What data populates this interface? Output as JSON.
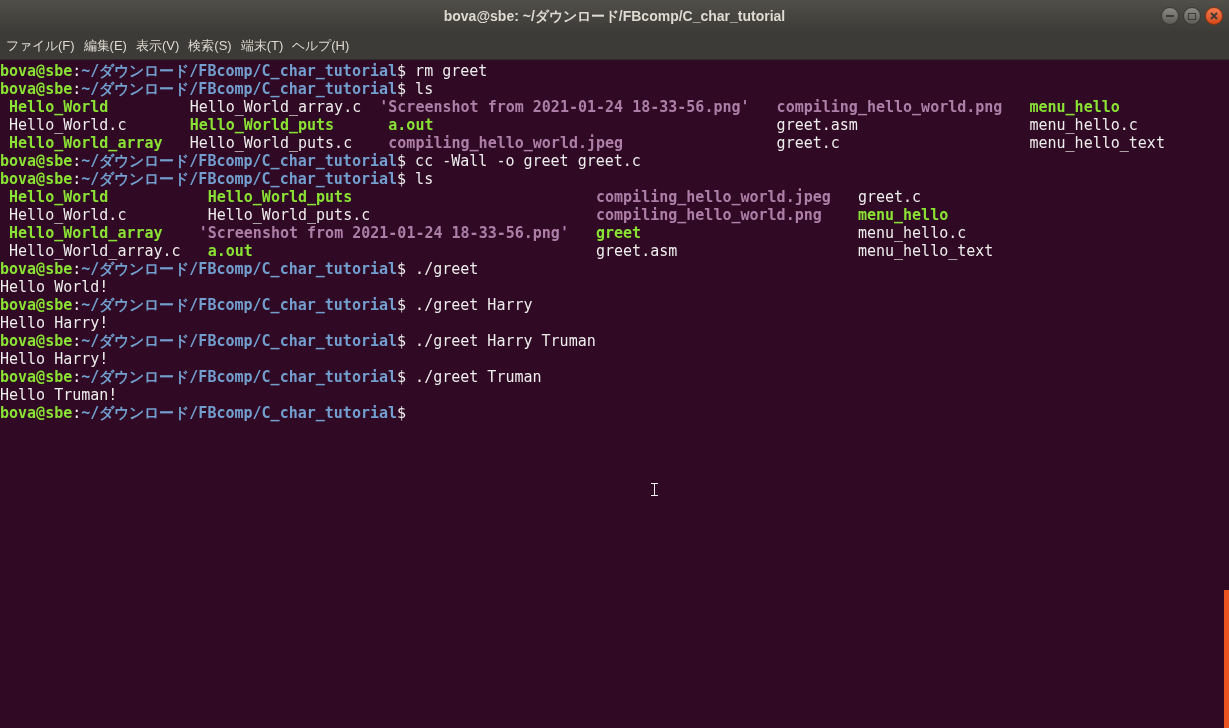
{
  "window": {
    "title": "bova@sbe: ~/ダウンロード/FBcomp/C_char_tutorial"
  },
  "menu": [
    "ファイル(F)",
    "編集(E)",
    "表示(V)",
    "検索(S)",
    "端末(T)",
    "ヘルプ(H)"
  ],
  "terminal": [
    {
      "kind": "prompt",
      "user": "bova@sbe",
      "sep": ":",
      "path": "~/ダウンロード/FBcomp/C_char_tutorial",
      "symbol": "$",
      "command": "rm greet"
    },
    {
      "kind": "prompt",
      "user": "bova@sbe",
      "sep": ":",
      "path": "~/ダウンロード/FBcomp/C_char_tutorial",
      "symbol": "$",
      "command": "ls"
    },
    {
      "kind": "listing",
      "columns": [
        [
          {
            "name": "Hello_World",
            "kind": "exec",
            "quoted": false
          },
          {
            "name": "Hello_World.c",
            "kind": "file",
            "quoted": false
          },
          {
            "name": "Hello_World_array",
            "kind": "exec",
            "quoted": false
          }
        ],
        [
          {
            "name": "Hello_World_array.c",
            "kind": "file",
            "quoted": false
          },
          {
            "name": "Hello_World_puts",
            "kind": "exec",
            "quoted": false
          },
          {
            "name": "Hello_World_puts.c",
            "kind": "file",
            "quoted": false
          }
        ],
        [
          {
            "name": "'Screenshot from 2021-01-24 18-33-56.png'",
            "kind": "image",
            "quoted": true
          },
          {
            "name": "a.out",
            "kind": "exec",
            "quoted": false
          },
          {
            "name": "compiling_hello_world.jpeg",
            "kind": "image",
            "quoted": false
          }
        ],
        [
          {
            "name": "compiling_hello_world.png",
            "kind": "image",
            "quoted": false
          },
          {
            "name": "greet.asm",
            "kind": "file",
            "quoted": false
          },
          {
            "name": "greet.c",
            "kind": "file",
            "quoted": false
          }
        ],
        [
          {
            "name": "menu_hello",
            "kind": "exec",
            "quoted": false
          },
          {
            "name": "menu_hello.c",
            "kind": "file",
            "quoted": false
          },
          {
            "name": "menu_hello_text",
            "kind": "file",
            "quoted": false
          }
        ]
      ]
    },
    {
      "kind": "prompt",
      "user": "bova@sbe",
      "sep": ":",
      "path": "~/ダウンロード/FBcomp/C_char_tutorial",
      "symbol": "$",
      "command": "cc -Wall -o greet greet.c"
    },
    {
      "kind": "prompt",
      "user": "bova@sbe",
      "sep": ":",
      "path": "~/ダウンロード/FBcomp/C_char_tutorial",
      "symbol": "$",
      "command": "ls"
    },
    {
      "kind": "listing",
      "columns": [
        [
          {
            "name": "Hello_World",
            "kind": "exec",
            "quoted": false
          },
          {
            "name": "Hello_World.c",
            "kind": "file",
            "quoted": false
          },
          {
            "name": "Hello_World_array",
            "kind": "exec",
            "quoted": false
          },
          {
            "name": "Hello_World_array.c",
            "kind": "file",
            "quoted": false
          }
        ],
        [
          {
            "name": "Hello_World_puts",
            "kind": "exec",
            "quoted": false
          },
          {
            "name": "Hello_World_puts.c",
            "kind": "file",
            "quoted": false
          },
          {
            "name": "'Screenshot from 2021-01-24 18-33-56.png'",
            "kind": "image",
            "quoted": true
          },
          {
            "name": "a.out",
            "kind": "exec",
            "quoted": false
          }
        ],
        [
          {
            "name": "compiling_hello_world.jpeg",
            "kind": "image",
            "quoted": false
          },
          {
            "name": "compiling_hello_world.png",
            "kind": "image",
            "quoted": false
          },
          {
            "name": "greet",
            "kind": "exec",
            "quoted": false
          },
          {
            "name": "greet.asm",
            "kind": "file",
            "quoted": false
          }
        ],
        [
          {
            "name": "greet.c",
            "kind": "file",
            "quoted": false
          },
          {
            "name": "menu_hello",
            "kind": "exec",
            "quoted": false
          },
          {
            "name": "menu_hello.c",
            "kind": "file",
            "quoted": false
          },
          {
            "name": "menu_hello_text",
            "kind": "file",
            "quoted": false
          }
        ]
      ]
    },
    {
      "kind": "prompt",
      "user": "bova@sbe",
      "sep": ":",
      "path": "~/ダウンロード/FBcomp/C_char_tutorial",
      "symbol": "$",
      "command": "./greet"
    },
    {
      "kind": "output",
      "text": "Hello World!"
    },
    {
      "kind": "prompt",
      "user": "bova@sbe",
      "sep": ":",
      "path": "~/ダウンロード/FBcomp/C_char_tutorial",
      "symbol": "$",
      "command": "./greet Harry"
    },
    {
      "kind": "output",
      "text": "Hello Harry!"
    },
    {
      "kind": "prompt",
      "user": "bova@sbe",
      "sep": ":",
      "path": "~/ダウンロード/FBcomp/C_char_tutorial",
      "symbol": "$",
      "command": "./greet Harry Truman"
    },
    {
      "kind": "output",
      "text": "Hello Harry!"
    },
    {
      "kind": "prompt",
      "user": "bova@sbe",
      "sep": ":",
      "path": "~/ダウンロード/FBcomp/C_char_tutorial",
      "symbol": "$",
      "command": "./greet Truman"
    },
    {
      "kind": "output",
      "text": "Hello Truman!"
    },
    {
      "kind": "prompt",
      "user": "bova@sbe",
      "sep": ":",
      "path": "~/ダウンロード/FBcomp/C_char_tutorial",
      "symbol": "$"
    }
  ]
}
